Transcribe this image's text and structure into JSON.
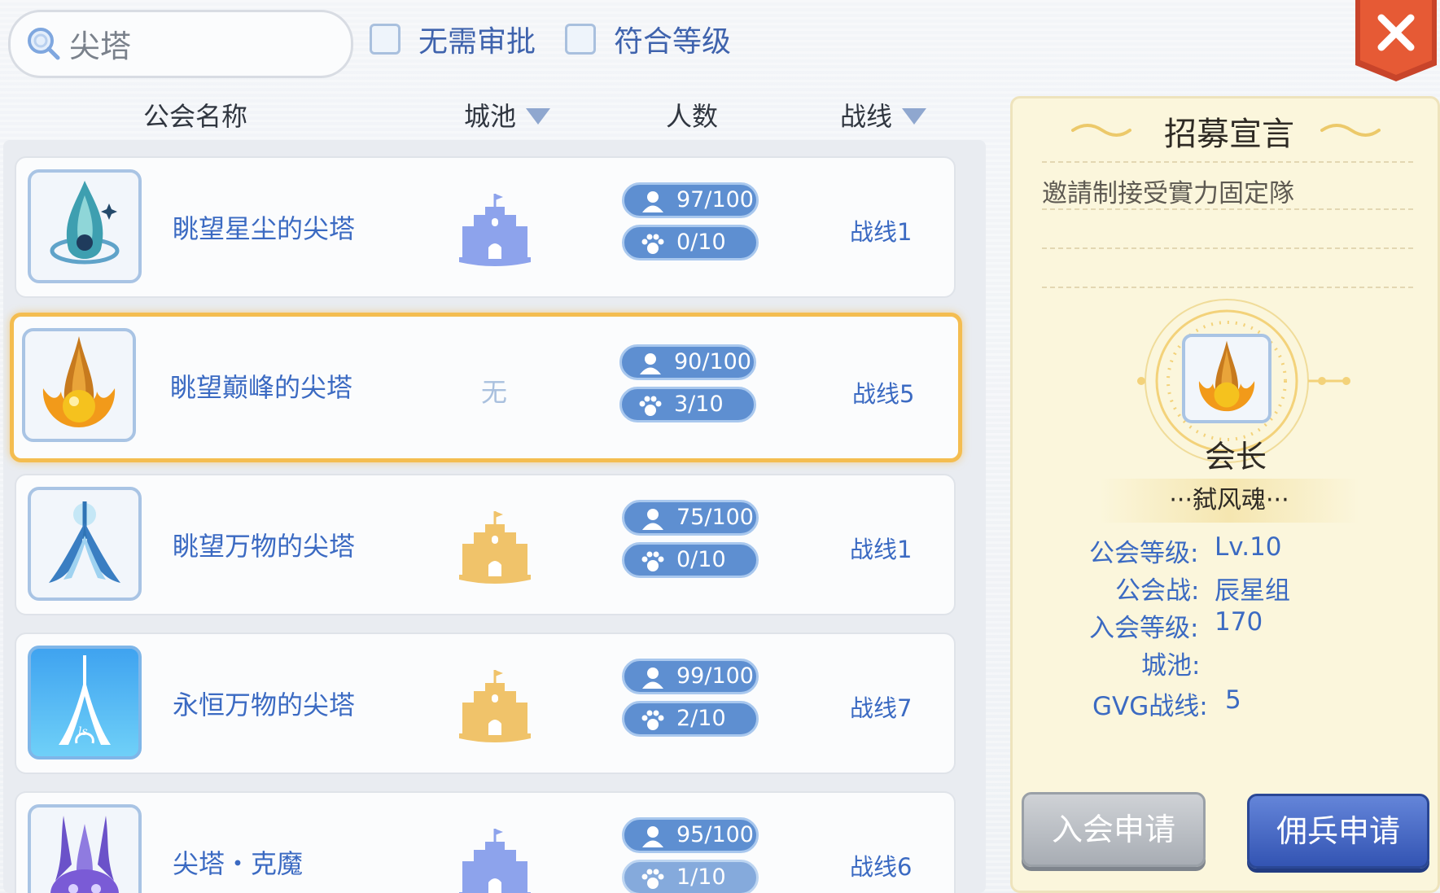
{
  "search": {
    "value": "尖塔"
  },
  "filters": [
    {
      "label": "无需审批",
      "checked": false
    },
    {
      "label": "符合等级",
      "checked": false
    }
  ],
  "columns": {
    "name": "公会名称",
    "city": "城池",
    "members": "人数",
    "line": "战线"
  },
  "guilds": [
    {
      "name": "眺望星尘的尖塔",
      "city": "blue-castle-icon",
      "city_text": "",
      "members": "97/100",
      "pets": "0/10",
      "line": "战线1",
      "selected": false
    },
    {
      "name": "眺望巅峰的尖塔",
      "city": "none",
      "city_text": "无",
      "members": "90/100",
      "pets": "3/10",
      "line": "战线5",
      "selected": true
    },
    {
      "name": "眺望万物的尖塔",
      "city": "gold-castle-icon",
      "city_text": "",
      "members": "75/100",
      "pets": "0/10",
      "line": "战线1",
      "selected": false
    },
    {
      "name": "永恒万物的尖塔",
      "city": "gold-castle-icon",
      "city_text": "",
      "members": "99/100",
      "pets": "2/10",
      "line": "战线7",
      "selected": false
    },
    {
      "name": "尖塔・克魔",
      "city": "blue-castle-icon",
      "city_text": "",
      "members": "95/100",
      "pets": "1/10",
      "line": "战线6",
      "selected": false
    }
  ],
  "detail": {
    "title": "招募宣言",
    "manifesto": "邀請制接受實力固定隊",
    "leader_label": "会长",
    "leader_name": "···弑风魂···",
    "fields": [
      {
        "label": "公会等级:",
        "value": "Lv.10"
      },
      {
        "label": "公会战:",
        "value": "辰星组"
      },
      {
        "label": "入会等级:",
        "value": "170"
      },
      {
        "label": "城池:",
        "value": ""
      },
      {
        "label": "GVG战线:",
        "value": "5"
      }
    ],
    "join_button": "入会申请",
    "merc_button": "佣兵申请"
  },
  "colors": {
    "accent_blue": "#3b6ac2",
    "selected_border": "#f4bd50",
    "close_red": "#e0532f"
  }
}
